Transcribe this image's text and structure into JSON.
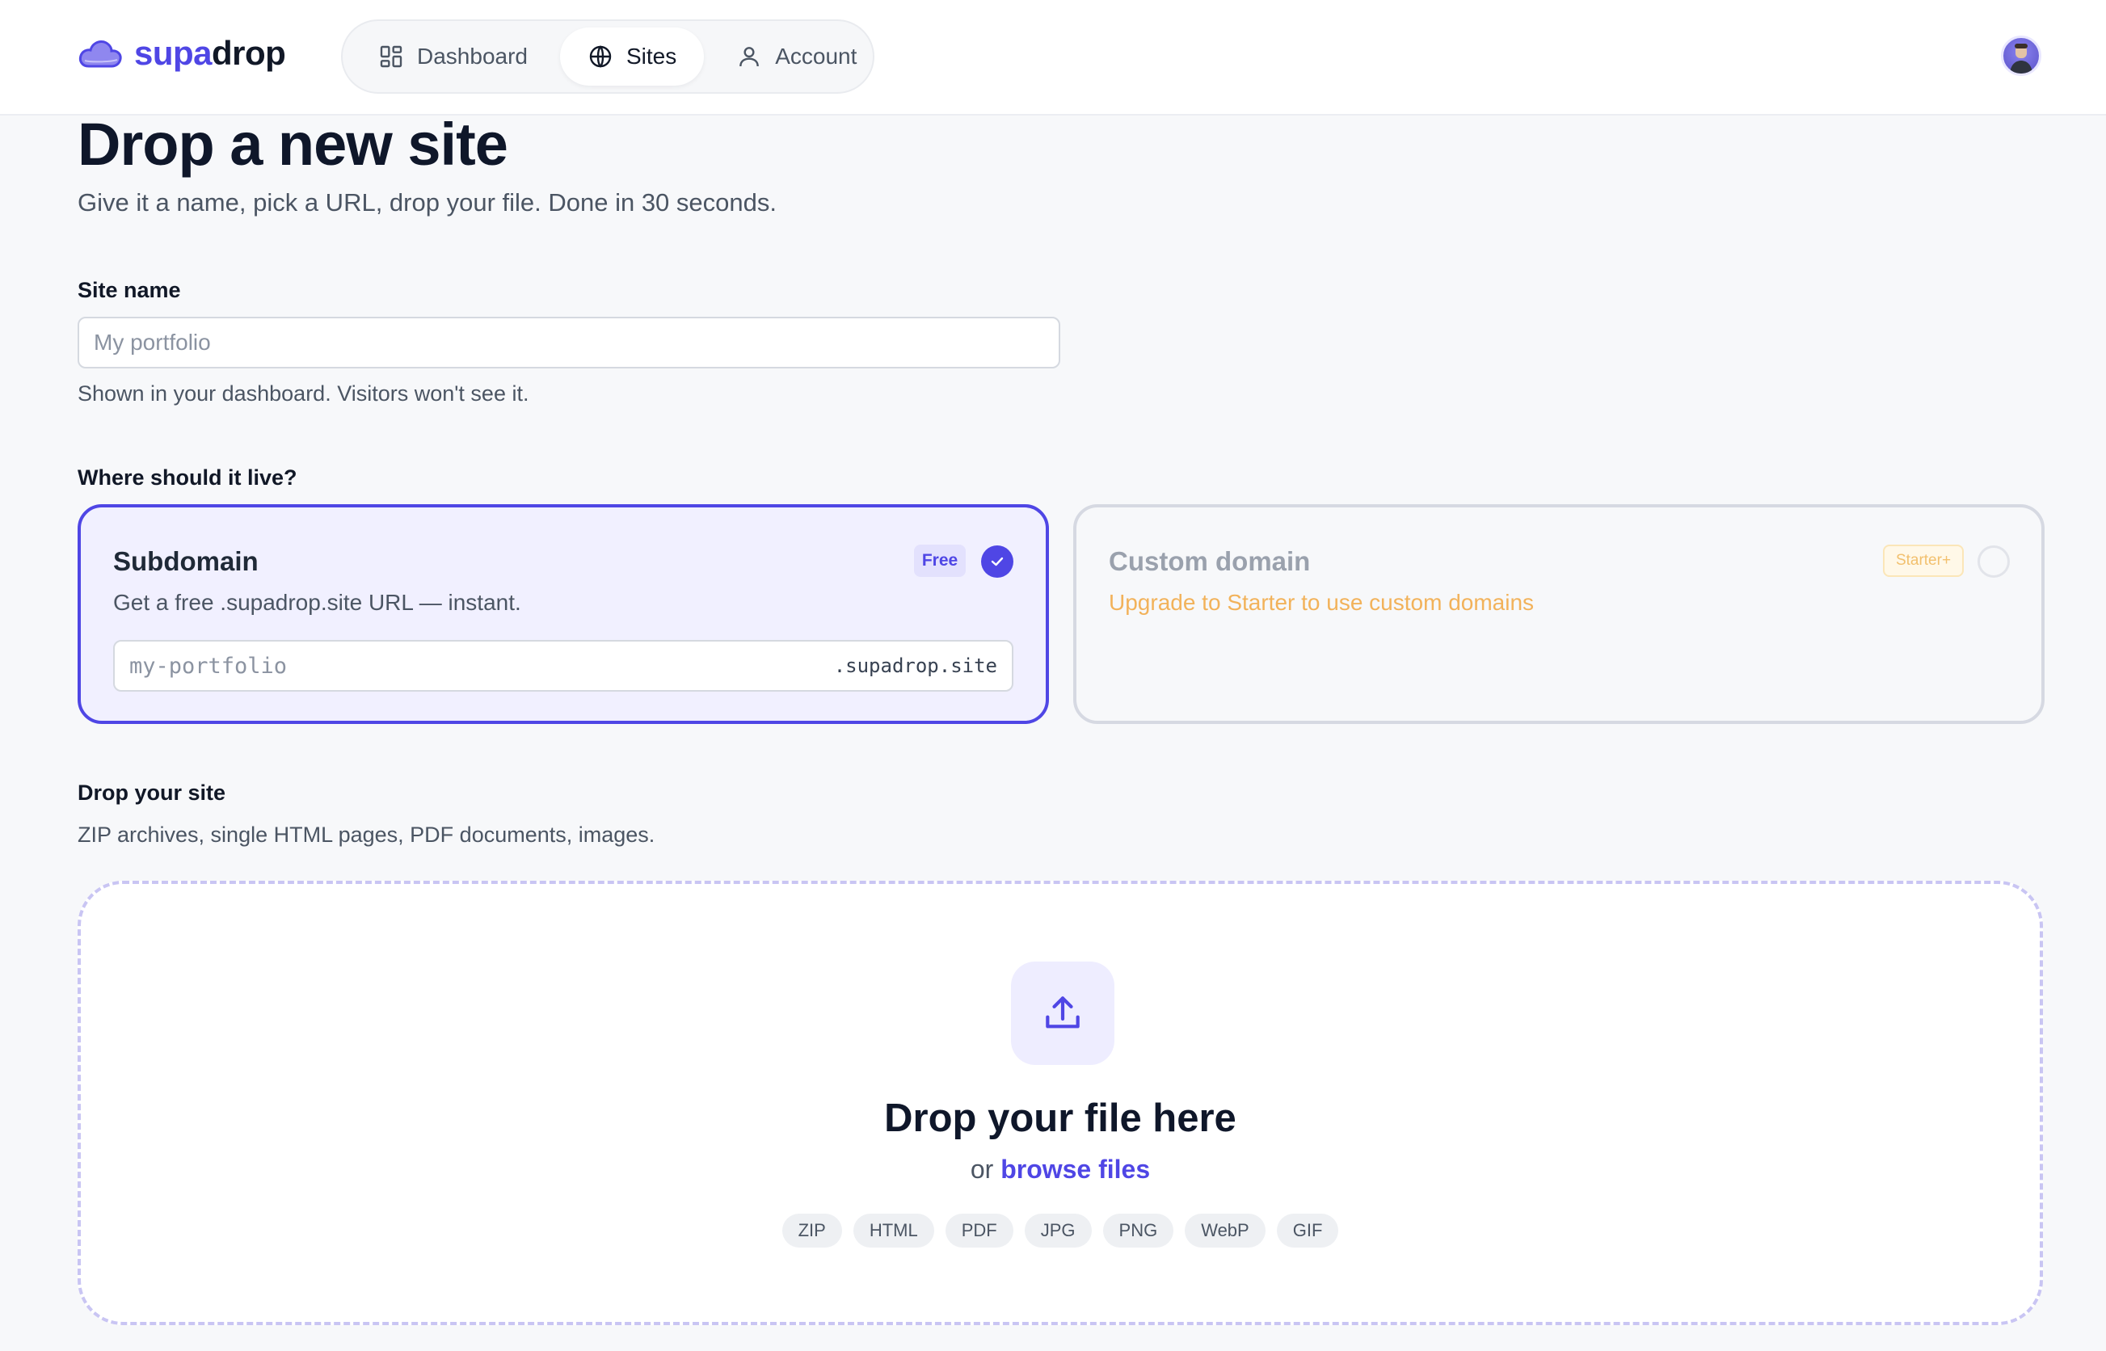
{
  "app": {
    "logo_part1": "supa",
    "logo_part2": "drop",
    "accent": "#4f46e5"
  },
  "nav": {
    "items": [
      {
        "label": "Dashboard",
        "icon": "dashboard-icon",
        "active": false
      },
      {
        "label": "Sites",
        "icon": "globe-icon",
        "active": true
      },
      {
        "label": "Account",
        "icon": "user-icon",
        "active": false
      }
    ]
  },
  "header": {
    "title": "Drop a new site",
    "subtitle": "Give it a name, pick a URL, drop your file. Done in 30 seconds."
  },
  "site_name": {
    "label": "Site name",
    "placeholder": "My portfolio",
    "value": "",
    "helper": "Shown in your dashboard. Visitors won't see it."
  },
  "location": {
    "label": "Where should it live?",
    "subdomain": {
      "title": "Subdomain",
      "badge": "Free",
      "description": "Get a free .supadrop.site URL — instant.",
      "placeholder": "my-portfolio",
      "suffix": ".supadrop.site",
      "selected": true
    },
    "custom": {
      "title": "Custom domain",
      "badge": "Starter+",
      "description": "Upgrade to Starter to use custom domains",
      "selected": false
    }
  },
  "upload": {
    "label": "Drop your site",
    "helper": "ZIP archives, single HTML pages, PDF documents, images.",
    "title": "Drop your file here",
    "or_text": "or",
    "browse": "browse files",
    "formats": [
      "ZIP",
      "HTML",
      "PDF",
      "JPG",
      "PNG",
      "WebP",
      "GIF"
    ]
  }
}
